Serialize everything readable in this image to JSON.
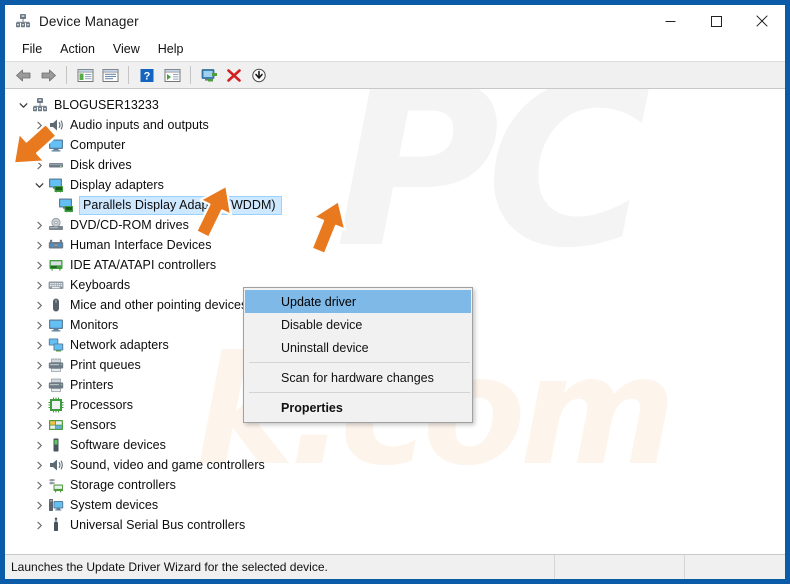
{
  "window": {
    "title": "Device Manager",
    "app_icon": "device-manager-icon",
    "minimize_label": "Minimize",
    "maximize_label": "Maximize",
    "close_label": "Close"
  },
  "menubar": {
    "items": [
      {
        "label": "File",
        "name": "menu-file"
      },
      {
        "label": "Action",
        "name": "menu-action"
      },
      {
        "label": "View",
        "name": "menu-view"
      },
      {
        "label": "Help",
        "name": "menu-help"
      }
    ]
  },
  "toolbar": {
    "buttons": [
      {
        "icon": "back-arrow-icon",
        "label": "Back"
      },
      {
        "icon": "forward-arrow-icon",
        "label": "Forward"
      },
      {
        "icon": "show-hide-console-tree-icon",
        "label": "Show/Hide Console Tree"
      },
      {
        "icon": "properties-icon",
        "label": "Properties"
      },
      {
        "icon": "help-icon",
        "label": "Help"
      },
      {
        "icon": "show-hide-action-pane-icon",
        "label": "Show/Hide Action Pane"
      },
      {
        "icon": "update-driver-icon",
        "label": "Update Driver Software"
      },
      {
        "icon": "uninstall-device-icon",
        "label": "Uninstall Device"
      },
      {
        "icon": "scan-hardware-changes-icon",
        "label": "Scan for hardware changes"
      }
    ]
  },
  "tree": {
    "root": {
      "label": "BLOGUSER13233",
      "icon": "computer-root-icon",
      "expanded": true
    },
    "items": [
      {
        "label": "Audio inputs and outputs",
        "icon": "speaker-icon",
        "expanded": false,
        "level": 1
      },
      {
        "label": "Computer",
        "icon": "monitor-icon",
        "expanded": false,
        "level": 1
      },
      {
        "label": "Disk drives",
        "icon": "disk-drive-icon",
        "expanded": false,
        "level": 1
      },
      {
        "label": "Display adapters",
        "icon": "display-adapter-icon",
        "expanded": true,
        "level": 1
      },
      {
        "label": "Parallels Display Adapter (WDDM)",
        "icon": "display-adapter-icon",
        "expanded": null,
        "level": 2,
        "selected": true
      },
      {
        "label": "DVD/CD-ROM drives",
        "icon": "dvd-drive-icon",
        "expanded": false,
        "level": 1
      },
      {
        "label": "Human Interface Devices",
        "icon": "hid-icon",
        "expanded": false,
        "level": 1
      },
      {
        "label": "IDE ATA/ATAPI controllers",
        "icon": "ide-controller-icon",
        "expanded": false,
        "level": 1
      },
      {
        "label": "Keyboards",
        "icon": "keyboard-icon",
        "expanded": false,
        "level": 1
      },
      {
        "label": "Mice and other pointing devices",
        "icon": "mouse-icon",
        "expanded": false,
        "level": 1
      },
      {
        "label": "Monitors",
        "icon": "monitor-icon",
        "expanded": false,
        "level": 1
      },
      {
        "label": "Network adapters",
        "icon": "network-adapter-icon",
        "expanded": false,
        "level": 1
      },
      {
        "label": "Print queues",
        "icon": "printer-icon",
        "expanded": false,
        "level": 1
      },
      {
        "label": "Printers",
        "icon": "printer-icon",
        "expanded": false,
        "level": 1
      },
      {
        "label": "Processors",
        "icon": "processor-icon",
        "expanded": false,
        "level": 1
      },
      {
        "label": "Sensors",
        "icon": "sensor-icon",
        "expanded": false,
        "level": 1
      },
      {
        "label": "Software devices",
        "icon": "software-device-icon",
        "expanded": false,
        "level": 1
      },
      {
        "label": "Sound, video and game controllers",
        "icon": "speaker-icon",
        "expanded": false,
        "level": 1
      },
      {
        "label": "Storage controllers",
        "icon": "storage-controller-icon",
        "expanded": false,
        "level": 1
      },
      {
        "label": "System devices",
        "icon": "system-device-icon",
        "expanded": false,
        "level": 1
      },
      {
        "label": "Universal Serial Bus controllers",
        "icon": "usb-icon",
        "expanded": false,
        "level": 1
      }
    ]
  },
  "context_menu": {
    "items": [
      {
        "label": "Update driver",
        "highlighted": true,
        "bold": false
      },
      {
        "label": "Disable device",
        "highlighted": false,
        "bold": false
      },
      {
        "label": "Uninstall device",
        "highlighted": false,
        "bold": false
      },
      {
        "separator": true
      },
      {
        "label": "Scan for hardware changes",
        "highlighted": false,
        "bold": false
      },
      {
        "separator": true
      },
      {
        "label": "Properties",
        "highlighted": false,
        "bold": true
      }
    ]
  },
  "statusbar": {
    "message": "Launches the Update Driver Wizard for the selected device.",
    "pane2": "",
    "pane3": ""
  },
  "annotations": {
    "arrows": [
      {
        "name": "arrow-pointing-display-adapters-expander"
      },
      {
        "name": "arrow-pointing-selected-device"
      },
      {
        "name": "arrow-pointing-update-driver"
      }
    ],
    "color": "#E8791E"
  },
  "watermark": {
    "logo_text": "PC",
    "domain_text": "k.com"
  },
  "colors": {
    "window_border": "#0A5BA6",
    "selection": "#CDE8FF",
    "menu_highlight": "#7EB9E8",
    "toolbar_bg": "#F0F0F0",
    "accent_orange": "#E8791E"
  }
}
